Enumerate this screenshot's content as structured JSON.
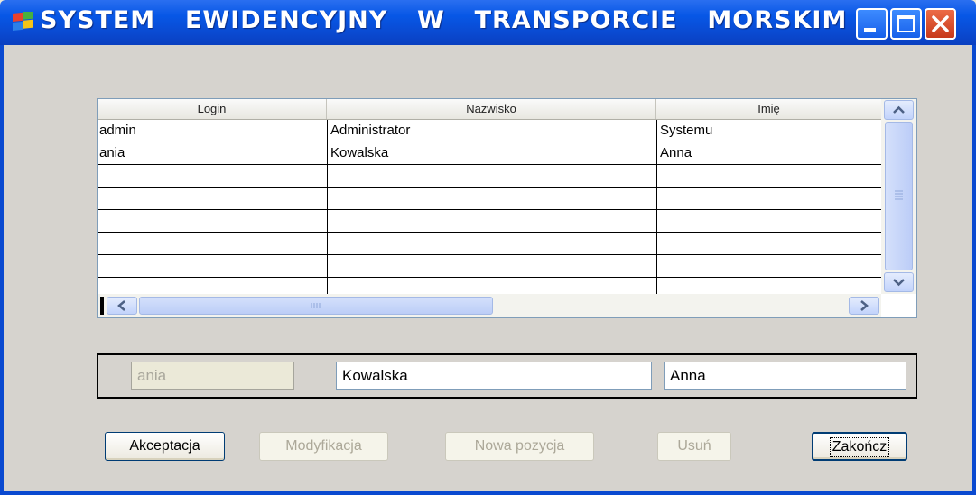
{
  "window": {
    "title": "SYSTEM  EWIDENCYJNY  W  TRANSPORCIE  MORSKIM",
    "icon": "windows-flag-icon",
    "controls": [
      "minimize-icon",
      "maximize-icon",
      "close-icon"
    ],
    "colors": {
      "titlebar": "#0a49d0",
      "client": "#d6d3ce",
      "close": "#c7391b"
    }
  },
  "grid": {
    "columns": [
      "Login",
      "Nazwisko",
      "Imię"
    ],
    "rows": [
      {
        "login": "admin",
        "nazwisko": "Administrator",
        "imie": "Systemu"
      },
      {
        "login": "ania",
        "nazwisko": "Kowalska",
        "imie": "Anna"
      },
      {
        "login": "",
        "nazwisko": "",
        "imie": ""
      },
      {
        "login": "",
        "nazwisko": "",
        "imie": ""
      },
      {
        "login": "",
        "nazwisko": "",
        "imie": ""
      },
      {
        "login": "",
        "nazwisko": "",
        "imie": ""
      },
      {
        "login": "",
        "nazwisko": "",
        "imie": ""
      },
      {
        "login": "",
        "nazwisko": "",
        "imie": ""
      }
    ]
  },
  "detail": {
    "login": "ania",
    "nazwisko": "Kowalska",
    "imie": "Anna"
  },
  "buttons": {
    "accept": "Akceptacja",
    "modify": "Modyfikacja",
    "new_item": "Nowa pozycja",
    "delete": "Usuń",
    "finish": "Zakończ"
  }
}
